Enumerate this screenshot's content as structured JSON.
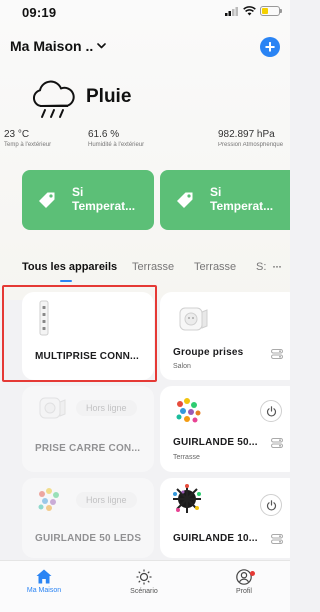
{
  "status_bar": {
    "time": "09:19"
  },
  "home": {
    "name": "Ma Maison ..",
    "add_label": "+"
  },
  "weather": {
    "condition": "Pluie",
    "temperature": {
      "value": "23 °C",
      "label": "Temp à l'extérieur"
    },
    "humidity": {
      "value": "61.6 %",
      "label": "Humidité à l'extérieur"
    },
    "pressure": {
      "value": "982.897 hPa",
      "label": "Pression Atmosphérique"
    }
  },
  "scenes": [
    {
      "title_line1": "Si",
      "title_line2": "Temperat..."
    },
    {
      "title_line1": "Si",
      "title_line2": "Temperat..."
    }
  ],
  "tabs": [
    {
      "label": "Tous les appareils"
    },
    {
      "label": "Terrasse"
    },
    {
      "label": "Terrasse"
    },
    {
      "label": "S:"
    }
  ],
  "tab_more": "···",
  "devices": [
    {
      "name": "MULTIPRISE CONN...",
      "room": "",
      "status": ""
    },
    {
      "name": "Groupe prises",
      "room": "Salon",
      "status": ""
    },
    {
      "name": "PRISE CARRÉ CON...",
      "room": "",
      "status": "Hors ligne"
    },
    {
      "name": "GUIRLANDE 50...",
      "room": "Terrasse",
      "status": ""
    },
    {
      "name": "GUIRLANDE 50 LEDS",
      "room": "",
      "status": "Hors ligne"
    },
    {
      "name": "GUIRLANDE 10...",
      "room": "",
      "status": ""
    }
  ],
  "nav": [
    {
      "label": "Ma Maison"
    },
    {
      "label": "Scénario"
    },
    {
      "label": "Profil"
    }
  ],
  "colors": {
    "accent": "#2a84f4",
    "scene_green": "#5cbf77",
    "highlight": "#e53935",
    "battery": "#f4d000"
  }
}
